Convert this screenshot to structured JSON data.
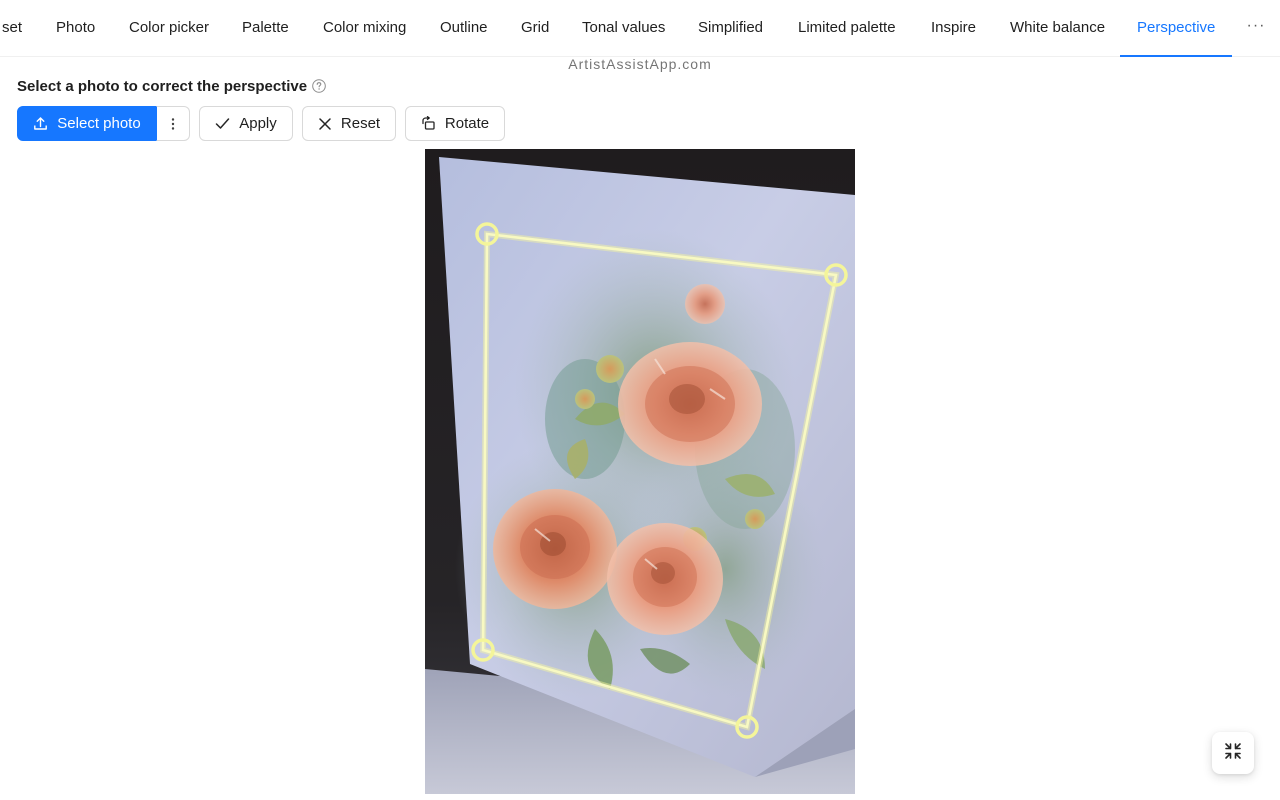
{
  "tabs": [
    {
      "label": "set"
    },
    {
      "label": "Photo"
    },
    {
      "label": "Color picker"
    },
    {
      "label": "Palette"
    },
    {
      "label": "Color mixing"
    },
    {
      "label": "Outline"
    },
    {
      "label": "Grid"
    },
    {
      "label": "Tonal values"
    },
    {
      "label": "Simplified"
    },
    {
      "label": "Limited palette"
    },
    {
      "label": "Inspire"
    },
    {
      "label": "White balance"
    },
    {
      "label": "Perspective"
    }
  ],
  "active_tab": "Perspective",
  "more_tabs_label": "···",
  "watermark": "ArtistAssistApp.com",
  "instruction": "Select a photo to correct the perspective",
  "toolbar": {
    "select_photo_label": "Select photo",
    "apply_label": "Apply",
    "reset_label": "Reset",
    "rotate_label": "Rotate"
  },
  "icons": {
    "help": "question-circle-icon",
    "select_photo": "upload-icon",
    "more": "more-vertical-icon",
    "apply": "check-icon",
    "reset": "close-icon",
    "rotate": "rotate-left-icon",
    "fullscreen": "fullscreen-exit-icon"
  },
  "colors": {
    "accent": "#1677ff",
    "handle": "#f4f59a"
  }
}
